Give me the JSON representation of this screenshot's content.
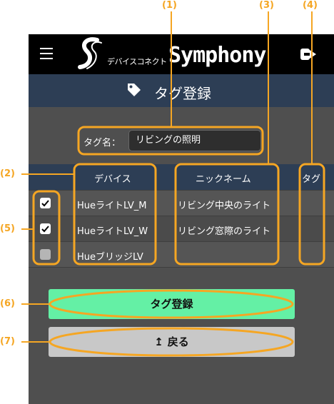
{
  "header": {
    "logo_jp": "デバイスコネクト",
    "logo_en": "Symphony"
  },
  "titlebar": {
    "title": "タグ登録"
  },
  "tag_form": {
    "label": "タグ名：",
    "value": "リビングの照明"
  },
  "table": {
    "headers": {
      "device": "デバイス",
      "nickname": "ニックネーム",
      "tag": "タグ"
    },
    "rows": [
      {
        "checked": true,
        "device": "HueライトLV_M",
        "nickname": "リビング中央のライト",
        "tag": ""
      },
      {
        "checked": true,
        "device": "HueライトLV_W",
        "nickname": "リビング窓際のライト",
        "tag": ""
      },
      {
        "checked": false,
        "device": "HueブリッジLV",
        "nickname": "",
        "tag": ""
      }
    ]
  },
  "buttons": {
    "register": "タグ登録",
    "back": "戻る"
  },
  "annotations": [
    "(1)",
    "(2)",
    "(3)",
    "(4)",
    "(5)",
    "(6)",
    "(7)"
  ],
  "colors": {
    "annotation": "#f5a623",
    "register_button": "#64f0a5",
    "back_button": "#c8c8c8",
    "header_bar": "#2d3e55"
  }
}
